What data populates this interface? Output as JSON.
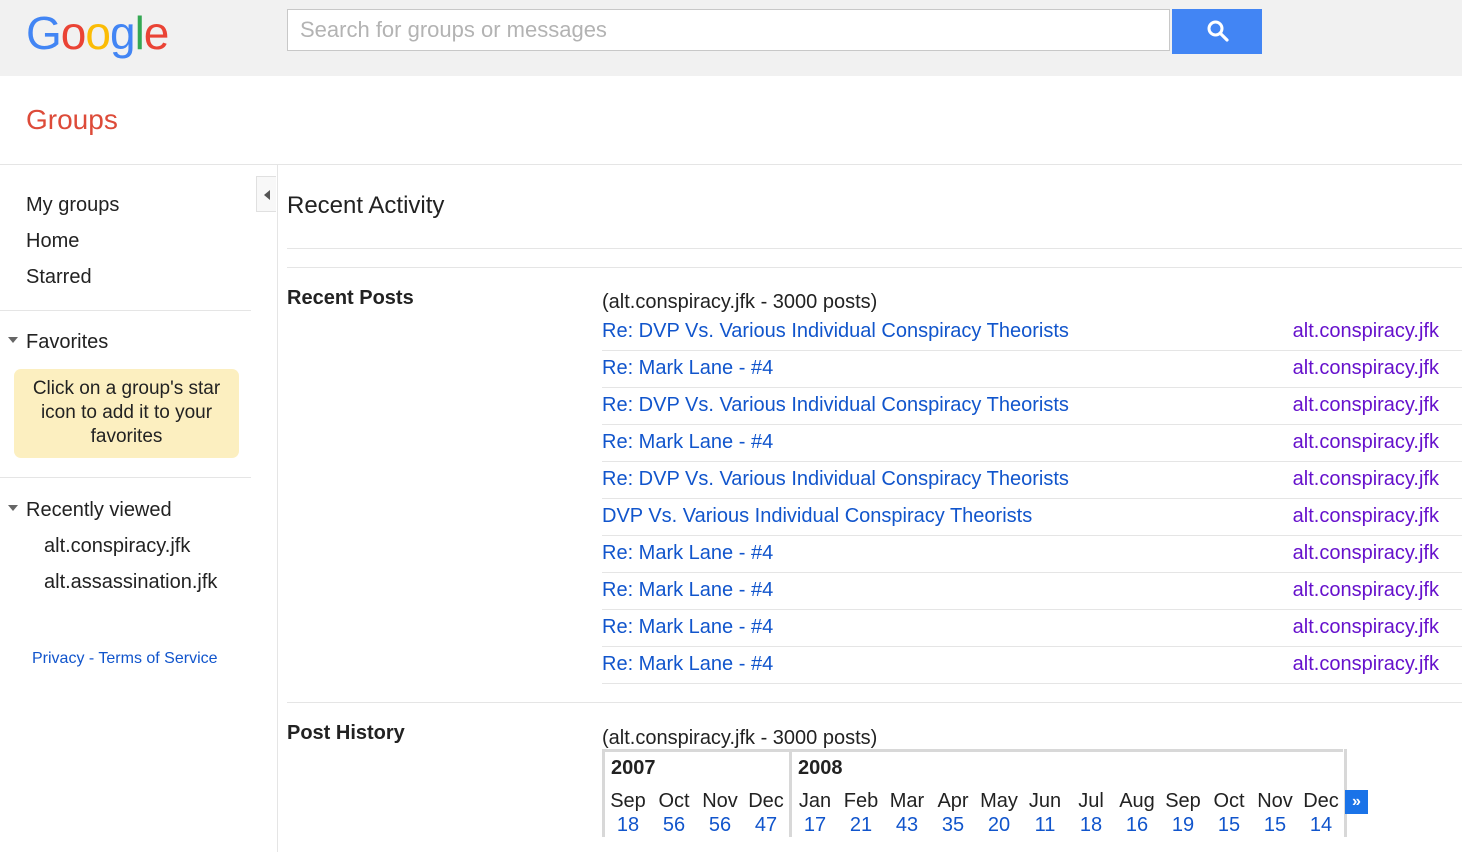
{
  "header": {
    "logo_letters": [
      {
        "ch": "G",
        "color": "#4285f4"
      },
      {
        "ch": "o",
        "color": "#ea4335"
      },
      {
        "ch": "o",
        "color": "#fbbc05"
      },
      {
        "ch": "g",
        "color": "#4285f4"
      },
      {
        "ch": "l",
        "color": "#34a853"
      },
      {
        "ch": "e",
        "color": "#ea4335"
      }
    ],
    "search_placeholder": "Search for groups or messages",
    "search_icon": "search-icon",
    "accent_color": "#4285f4"
  },
  "app_title": "Groups",
  "sidebar": {
    "nav": [
      "My groups",
      "Home",
      "Starred"
    ],
    "favorites_heading": "Favorites",
    "favorites_hint": "Click on a group's star icon to add it to your favorites",
    "recently_viewed_heading": "Recently viewed",
    "recently_viewed": [
      "alt.conspiracy.jfk",
      "alt.assassination.jfk"
    ],
    "footer": {
      "privacy": "Privacy",
      "separator": " - ",
      "terms": "Terms of Service"
    }
  },
  "main": {
    "title": "Recent Activity",
    "recent_posts_label": "Recent Posts",
    "recent_posts_count": "(alt.conspiracy.jfk - 3000 posts)",
    "posts": [
      {
        "title": "Re: DVP Vs. Various Individual Conspiracy Theorists",
        "group": "alt.conspiracy.jfk"
      },
      {
        "title": "Re: Mark Lane - #4",
        "group": "alt.conspiracy.jfk"
      },
      {
        "title": "Re: DVP Vs. Various Individual Conspiracy Theorists",
        "group": "alt.conspiracy.jfk"
      },
      {
        "title": "Re: Mark Lane - #4",
        "group": "alt.conspiracy.jfk"
      },
      {
        "title": "Re: DVP Vs. Various Individual Conspiracy Theorists",
        "group": "alt.conspiracy.jfk"
      },
      {
        "title": "DVP Vs. Various Individual Conspiracy Theorists",
        "group": "alt.conspiracy.jfk"
      },
      {
        "title": "Re: Mark Lane - #4",
        "group": "alt.conspiracy.jfk"
      },
      {
        "title": "Re: Mark Lane - #4",
        "group": "alt.conspiracy.jfk"
      },
      {
        "title": "Re: Mark Lane - #4",
        "group": "alt.conspiracy.jfk"
      },
      {
        "title": "Re: Mark Lane - #4",
        "group": "alt.conspiracy.jfk"
      }
    ],
    "post_history_label": "Post History",
    "post_history_count": "(alt.conspiracy.jfk - 3000 posts)",
    "history": [
      {
        "year": "2007",
        "months": [
          {
            "name": "Sep",
            "count": "18"
          },
          {
            "name": "Oct",
            "count": "56"
          },
          {
            "name": "Nov",
            "count": "56"
          },
          {
            "name": "Dec",
            "count": "47"
          }
        ]
      },
      {
        "year": "2008",
        "months": [
          {
            "name": "Jan",
            "count": "17"
          },
          {
            "name": "Feb",
            "count": "21"
          },
          {
            "name": "Mar",
            "count": "43"
          },
          {
            "name": "Apr",
            "count": "35"
          },
          {
            "name": "May",
            "count": "20"
          },
          {
            "name": "Jun",
            "count": "11"
          },
          {
            "name": "Jul",
            "count": "18"
          },
          {
            "name": "Aug",
            "count": "16"
          },
          {
            "name": "Sep",
            "count": "19"
          },
          {
            "name": "Oct",
            "count": "15"
          },
          {
            "name": "Nov",
            "count": "15"
          },
          {
            "name": "Dec",
            "count": "14"
          }
        ]
      }
    ],
    "next_label": "»"
  }
}
